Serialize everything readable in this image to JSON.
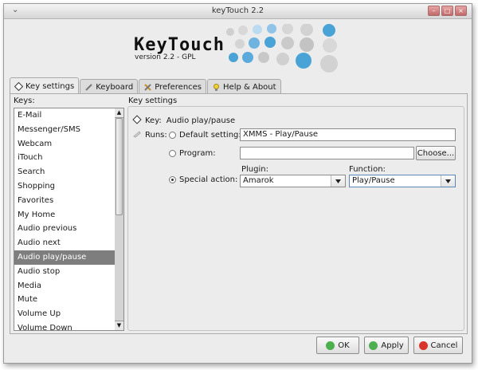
{
  "window": {
    "title": "keyTouch 2.2"
  },
  "header": {
    "logo_text": "KeyTouch",
    "version": "version 2.2 - GPL"
  },
  "tabs": [
    {
      "label": "Key settings",
      "icon": "key-settings-icon"
    },
    {
      "label": "Keyboard",
      "icon": "keyboard-icon"
    },
    {
      "label": "Preferences",
      "icon": "preferences-icon"
    },
    {
      "label": "Help & About",
      "icon": "help-icon"
    }
  ],
  "keys": {
    "label": "Keys:",
    "items": [
      "E-Mail",
      "Messenger/SMS",
      "Webcam",
      "iTouch",
      "Search",
      "Shopping",
      "Favorites",
      "My Home",
      "Audio previous",
      "Audio next",
      "Audio play/pause",
      "Audio stop",
      "Media",
      "Mute",
      "Volume Up",
      "Volume Down"
    ],
    "selected": "Audio play/pause"
  },
  "settings": {
    "group_title": "Key settings",
    "key_label": "Key:",
    "key_value": "Audio play/pause",
    "runs_label": "Runs:",
    "default_setting_label": "Default setting:",
    "default_setting_value": "XMMS - Play/Pause",
    "program_label": "Program:",
    "program_value": "",
    "choose_label": "Choose...",
    "special_action_label": "Special action:",
    "plugin_label": "Plugin:",
    "plugin_value": "Amarok",
    "function_label": "Function:",
    "function_value": "Play/Pause"
  },
  "buttons": {
    "ok": "OK",
    "apply": "Apply",
    "cancel": "Cancel"
  },
  "colors": {
    "ok_icon": "#4caf50",
    "apply_icon": "#4caf50",
    "cancel_icon": "#d9342b",
    "selection": "#7e7e7e",
    "dot_blue": "#4aa3d6",
    "dot_gray": "#c8c8c8"
  }
}
